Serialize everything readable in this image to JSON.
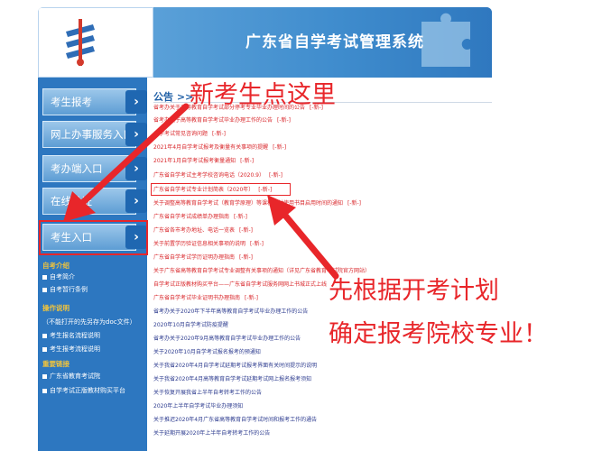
{
  "header": {
    "title": "广东省自学考试管理系统",
    "logo_icon": "exam-logo-icon",
    "bg_color": "#3a86c6"
  },
  "sidebar": {
    "items": [
      {
        "label": "考生报考"
      },
      {
        "label": "网上办事服务入口"
      },
      {
        "label": "考办端入口"
      },
      {
        "label": "在线验证"
      },
      {
        "label": "考生入口"
      }
    ],
    "sections": [
      {
        "title": "自考介绍",
        "links": [
          "自考简介",
          "自考暂行条例"
        ]
      },
      {
        "title": "操作说明",
        "links": [
          "（不能打开的先另存为doc文件）",
          "考生报名流程说明",
          "考生报考流程说明"
        ]
      },
      {
        "title": "重要链接",
        "links": [
          "广东省教育考试院",
          "自学考试正版教材购买平台"
        ]
      }
    ]
  },
  "main": {
    "section_title": "公告 >>",
    "notices": [
      {
        "text": "省考办关于高等教育自学考试部分停考专业毕业办理时间的公告",
        "new": "[-新-]"
      },
      {
        "text": "省考办关于高等教育自学考试毕业办理工作的公告",
        "new": "[-新-]"
      },
      {
        "text": "自学考试常见咨询问题",
        "new": "[-新-]"
      },
      {
        "text": "2021年4月自学考试报考及衡量有关事项的提醒",
        "new": "[-新-]"
      },
      {
        "text": "2021年1月自学考试报考衡量通知",
        "new": "[-新-]"
      },
      {
        "text": "广东省自学考试主考学校咨询电话（2020.9）",
        "new": "[-新-]"
      },
      {
        "text": "广东省自学考试专业计划简表（2020年）",
        "new": "[-新-]"
      },
      {
        "text": "关于调整高等教育自学考试（教育学原理）等课程教材使用书目启用时间的通知",
        "new": "[-新-]"
      },
      {
        "text": "广东省自学考试成绩单办理指南",
        "new": "[-新-]"
      },
      {
        "text": "广东省各市考办地址、电话一览表",
        "new": "[-新-]"
      },
      {
        "text": "关于前置学历验证信息相关事项的说明",
        "new": "[-新-]"
      },
      {
        "text": "广东省自学考试学历证明办理指南",
        "new": "[-新-]"
      },
      {
        "text": "关于广东省高等教育自学考试专业调整有关事项的通知（详见广东省教育考试院官方网站）",
        "new": ""
      },
      {
        "text": "自学考试正版教材购买平台——广东省自学考试服务网网上书城正式上线",
        "new": ""
      },
      {
        "text": "广东省自学考试毕业证明书办理指南",
        "new": "[-新-]"
      },
      {
        "text": "省考办关于2020年下半年高等教育自学考试毕业办理工作的公告",
        "new": ""
      },
      {
        "text": "2020年10月自学考试防疫提醒",
        "new": ""
      },
      {
        "text": "省考办关于2020年9月高等教育自学考试毕业办理工作的公告",
        "new": ""
      },
      {
        "text": "关于2020年10月自学考试报名报考的预通知",
        "new": ""
      },
      {
        "text": "关于我省2020年4月自学考试延期考试报考界面有关时间提示的说明",
        "new": ""
      },
      {
        "text": "关于我省2020年4月高等教育自学考试延期考试网上报名报考须知",
        "new": ""
      },
      {
        "text": "关于恢复开展我省上半年自考转考工作的公告",
        "new": ""
      },
      {
        "text": "2020年上半年自学考试毕业办理须知",
        "new": ""
      },
      {
        "text": "关于推迟2020年4月广东省高等教育自学考试时间和报考工作的通告",
        "new": ""
      },
      {
        "text": "关于延期开展2020年上半年自考转考工作的公告",
        "new": ""
      }
    ]
  },
  "annotations": {
    "top": "新考生点这里",
    "middle": "先根据开考计划",
    "bottom": "确定报考院校专业！",
    "color": "#e8262a"
  }
}
